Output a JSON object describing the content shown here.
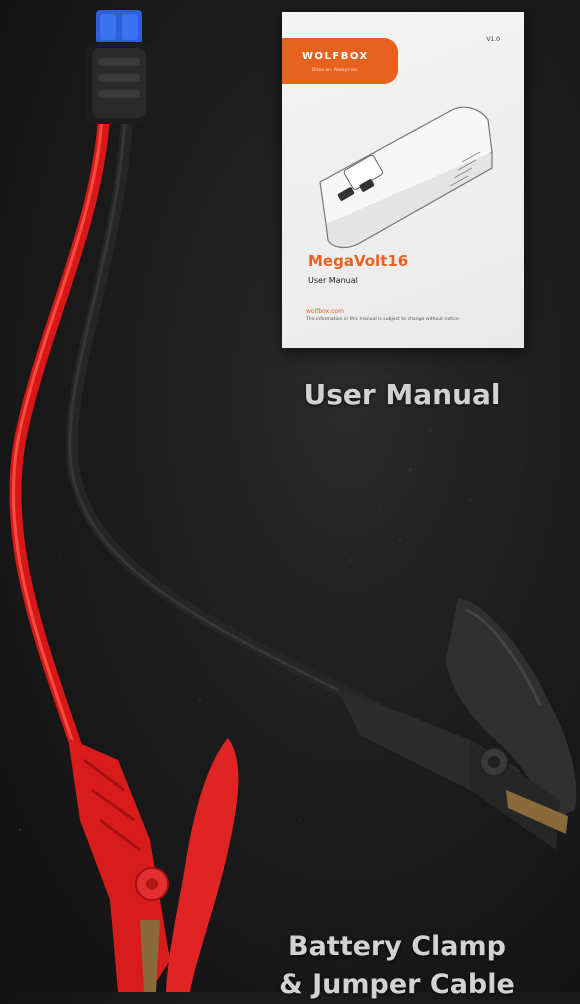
{
  "manual": {
    "brand": "WOLFBOX",
    "tagline": "Drive on. Always on.",
    "version": "V1.0",
    "product_name": "MegaVolt16",
    "subtitle": "User Manual",
    "website": "wolfbox.com",
    "notice": "The information in this manual is subject to change without notice."
  },
  "captions": {
    "manual": "User Manual",
    "clamp_line1": "Battery Clamp",
    "clamp_line2": "& Jumper Cable"
  },
  "colors": {
    "background": "#1a1a1a",
    "accent": "#e8621f",
    "red_cable": "#e21c1c",
    "black_cable": "#262626",
    "connector_blue": "#2f5fd8"
  },
  "icons": [
    "ec5-connector-icon",
    "red-clamp-icon",
    "black-clamp-icon",
    "jump-starter-device-icon"
  ]
}
